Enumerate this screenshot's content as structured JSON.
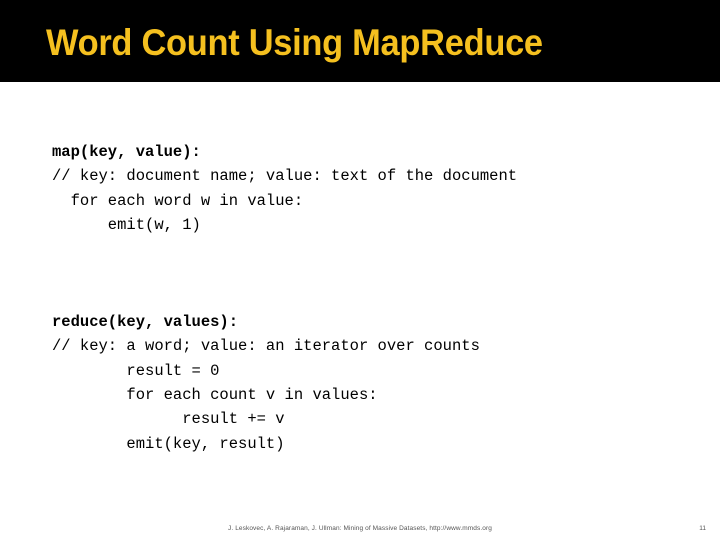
{
  "slide": {
    "title": "Word Count Using MapReduce",
    "title_color": "#F5C01F",
    "title_band_color": "#000000",
    "background_color": "#FFFFFF",
    "body_text_color": "#000000"
  },
  "code": {
    "lines": [
      {
        "text": "map(key, value):",
        "bold": true
      },
      {
        "text": "// key: document name; value: text of the document",
        "bold": false
      },
      {
        "text": "  for each word w in value:",
        "bold": false
      },
      {
        "text": "      emit(w, 1)",
        "bold": false
      },
      {
        "text": "",
        "bold": false
      },
      {
        "text": "",
        "bold": false
      },
      {
        "text": "",
        "bold": false
      },
      {
        "text": "reduce(key, values):",
        "bold": true
      },
      {
        "text": "// key: a word; value: an iterator over counts",
        "bold": false
      },
      {
        "text": "        result = 0",
        "bold": false
      },
      {
        "text": "        for each count v in values:",
        "bold": false
      },
      {
        "text": "              result += v",
        "bold": false
      },
      {
        "text": "        emit(key, result)",
        "bold": false
      }
    ]
  },
  "footer": {
    "citation": "J. Leskovec, A. Rajaraman, J. Ullman: Mining of Massive Datasets, http://www.mmds.org",
    "page_number": "11",
    "text_color": "#555555"
  }
}
